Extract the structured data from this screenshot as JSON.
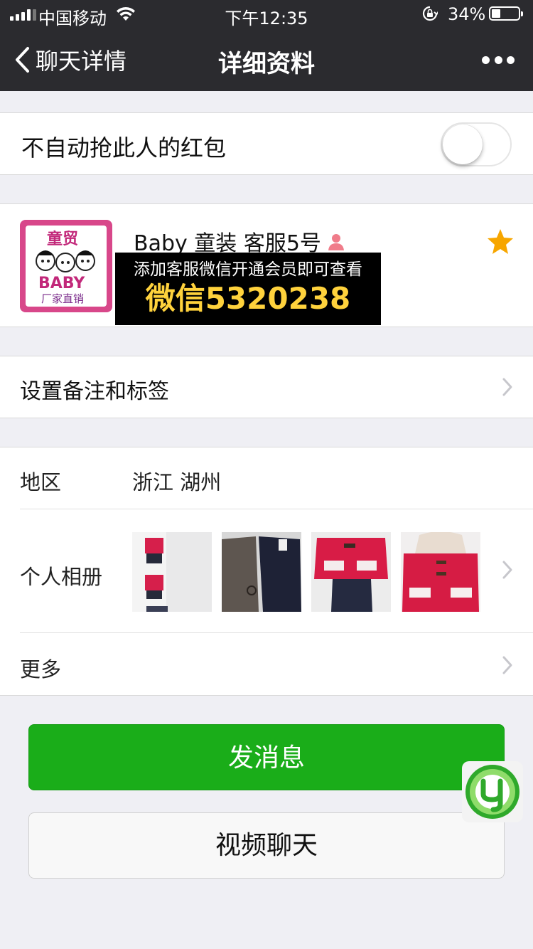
{
  "status_bar": {
    "carrier": "中国移动",
    "time": "下午12:35",
    "battery": "34%",
    "battery_level": 0.34
  },
  "nav": {
    "back_label": "聊天详情",
    "title": "详细资料"
  },
  "settings": {
    "no_grab_label": "不自动抢此人的红包",
    "no_grab_on": false
  },
  "profile": {
    "nickname": "Baby 童装 客服5号",
    "promo_line1": "添加客服微信开通会员即可查看",
    "promo_line2": "微信5320238",
    "avatar_text_top": "童贸",
    "avatar_text_mid": "BABY",
    "avatar_text_bottom": "厂家直销",
    "starred": true
  },
  "remark": {
    "label": "设置备注和标签"
  },
  "info": {
    "region_label": "地区",
    "region_value": "浙江 湖州",
    "album_label": "个人相册",
    "more_label": "更多"
  },
  "actions": {
    "message_label": "发消息",
    "video_label": "视频聊天"
  },
  "colors": {
    "nav_bg": "#2b2b2f",
    "page_bg": "#efeff4",
    "primary_green": "#1aad19",
    "star": "#f7a600",
    "promo_yellow": "#ffd23c"
  }
}
